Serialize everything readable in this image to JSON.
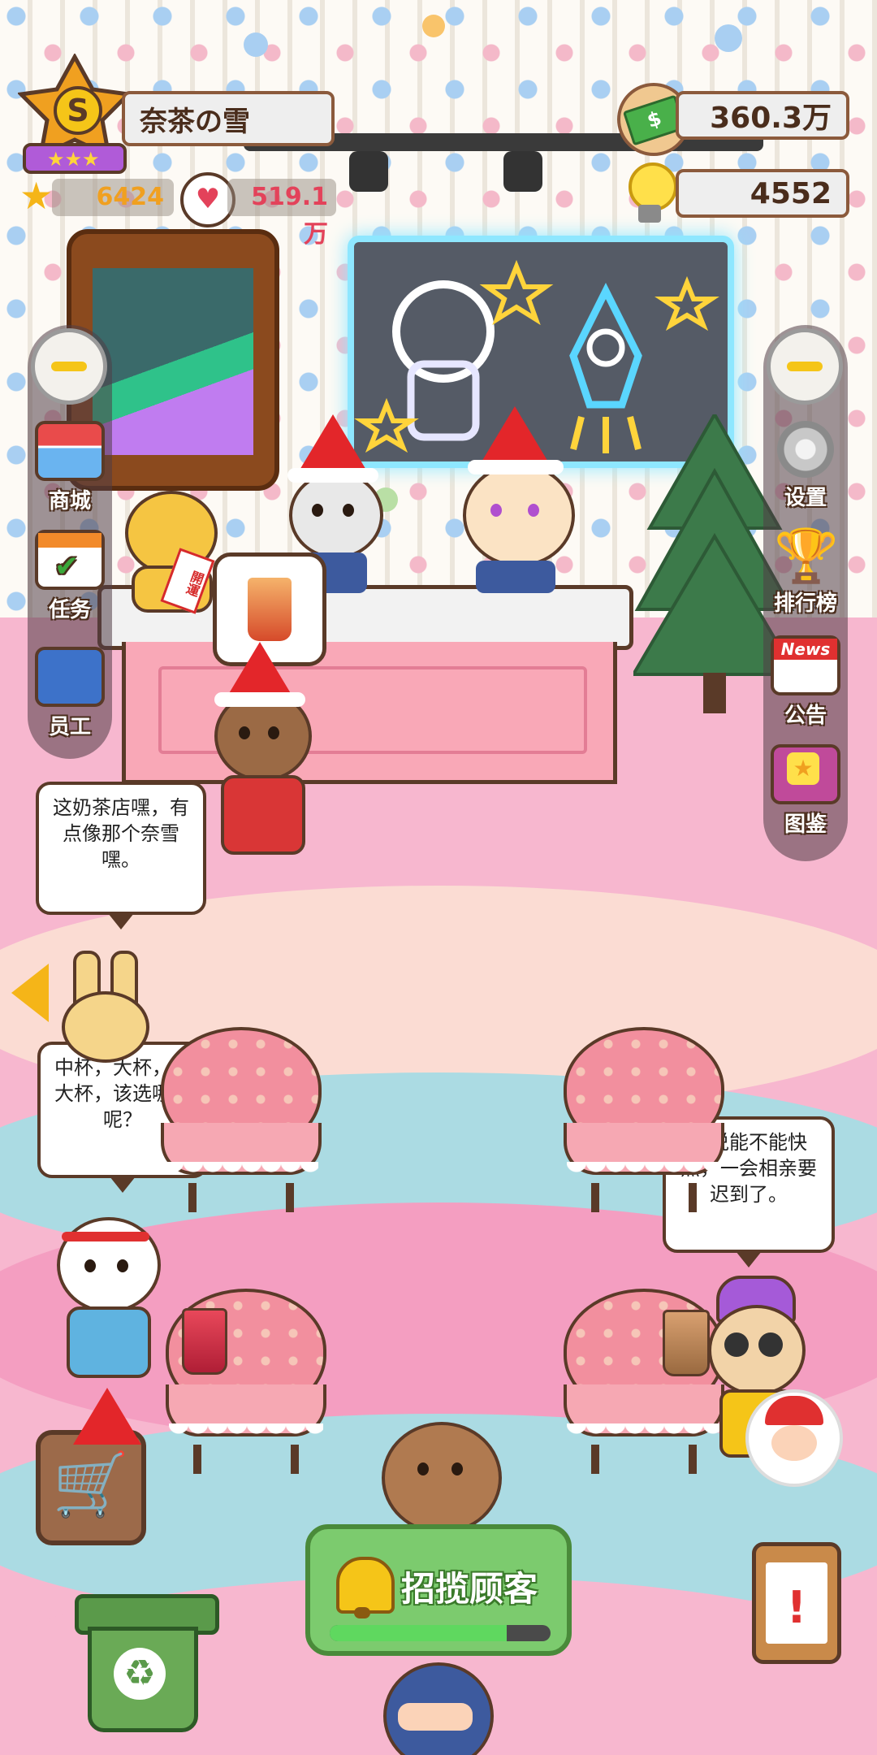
{
  "player": {
    "name": "奈茶の雪",
    "rank": "S",
    "stars_value": "6424",
    "hearts_value": "519.1万"
  },
  "currency": {
    "money": "360.3万",
    "ideas": "4552"
  },
  "left_menu": [
    {
      "label": "商城",
      "icon": "shop-icon"
    },
    {
      "label": "任务",
      "icon": "task-calendar-icon"
    },
    {
      "label": "员工",
      "icon": "staff-icon"
    }
  ],
  "right_menu": [
    {
      "label": "设置",
      "icon": "gear-icon"
    },
    {
      "label": "排行榜",
      "icon": "trophy-icon"
    },
    {
      "label": "公告",
      "icon": "news-icon"
    },
    {
      "label": "图鉴",
      "icon": "book-icon"
    }
  ],
  "news_icon_text": "News",
  "maneki_sign": "開運",
  "speech_bubbles": {
    "deer_customer": "这奶茶店嘿，有点像那个奈雪嘿。",
    "rabbit_customer": "中杯，大杯，超大杯，该选哪个呢？",
    "pug_customer": "我说能不能快点，一会相亲要迟到了。"
  },
  "bottom_bar": {
    "attract_label": "招揽顾客",
    "attract_progress": 0.8
  },
  "colors": {
    "accent_green": "#7ccb6e",
    "brand_brown": "#8b5a3c",
    "floor_pink": "#f7b7cf"
  }
}
